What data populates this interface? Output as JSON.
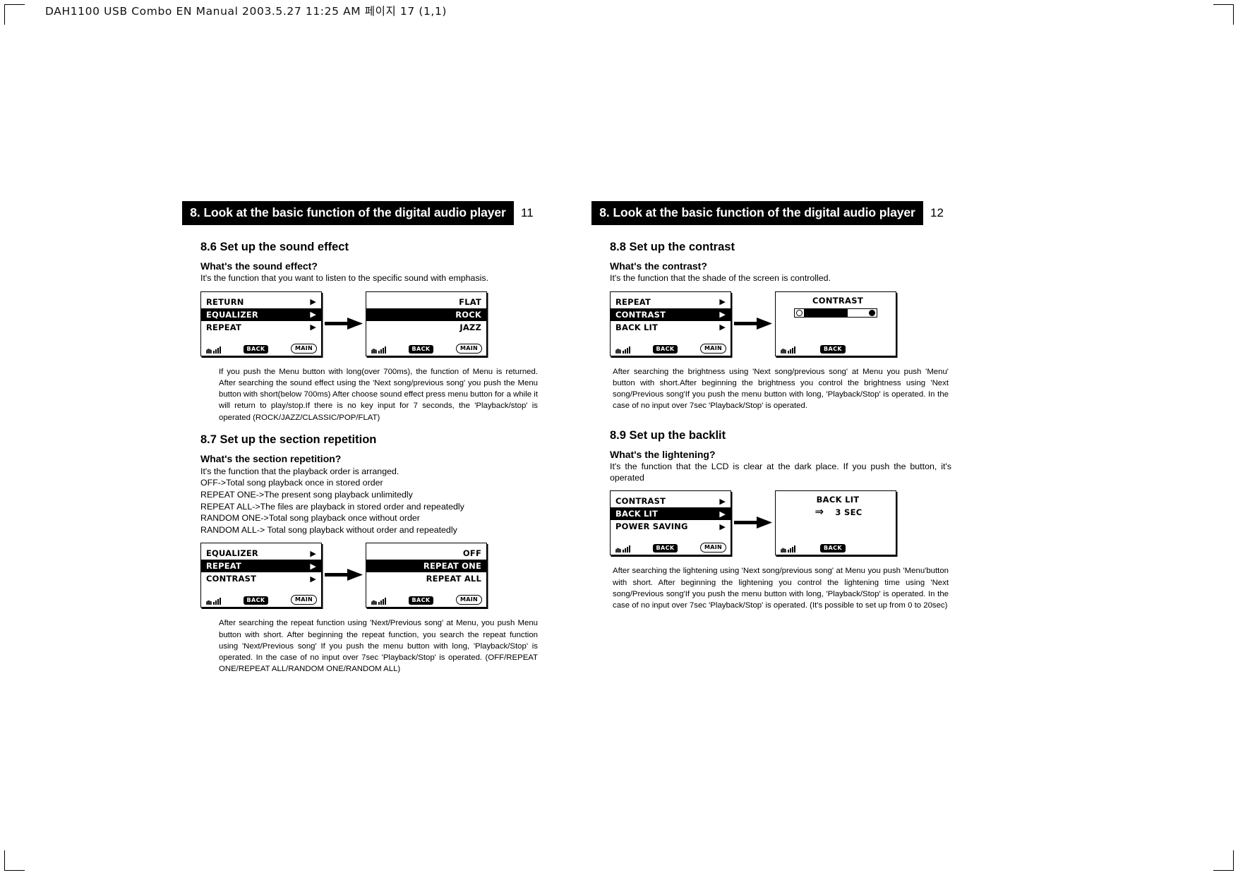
{
  "print_header": "DAH1100 USB Combo EN Manual  2003.5.27 11:25 AM  페이지 17 (1,1)",
  "left_page": {
    "banner": "8. Look at the basic function of the digital audio player",
    "page_number": "11",
    "section_86": {
      "title": "8.6 Set up the sound effect",
      "question": "What's the sound effect?",
      "answer": "It's the function that you want to listen to the specific sound with emphasis.",
      "figure": {
        "screen_a": {
          "rows": [
            {
              "label": "RETURN",
              "selected": false,
              "arrow": "▶"
            },
            {
              "label": "EQUALIZER",
              "selected": true,
              "arrow": "▶"
            },
            {
              "label": "REPEAT",
              "selected": false,
              "arrow": "▶"
            }
          ],
          "status": {
            "signal": "signal-icon",
            "back": "BACK",
            "main": "MAIN"
          }
        },
        "arrow": "→",
        "screen_b": {
          "rows": [
            {
              "label": "FLAT",
              "selected": false
            },
            {
              "label": "ROCK",
              "selected": true
            },
            {
              "label": "JAZZ",
              "selected": false
            }
          ],
          "status": {
            "signal": "signal-icon",
            "back": "BACK",
            "main": "MAIN"
          }
        }
      },
      "note": "If you push the Menu button with long(over 700ms), the function of Menu is returned. After searching the sound effect using the 'Next song/previous song' you push the Menu button with short(below 700ms) After choose sound effect press menu button for a while it will return to play/stop.If there is no key input for 7 seconds, the 'Playback/stop' is operated (ROCK/JAZZ/CLASSIC/POP/FLAT)"
    },
    "section_87": {
      "title": "8.7 Set up the section repetition",
      "question": "What's the section repetition?",
      "lines": [
        "It's the function that the playback order is arranged.",
        "OFF->Total song playback once in stored order",
        "REPEAT ONE->The present song playback unlimitedly",
        "REPEAT ALL->The files are playback in stored order and repeatedly",
        "RANDOM ONE->Total song playback once without order",
        "RANDOM ALL-> Total song playback without order and repeatedly"
      ],
      "figure": {
        "screen_a": {
          "rows": [
            {
              "label": "EQUALIZER",
              "selected": false,
              "arrow": "▶"
            },
            {
              "label": "REPEAT",
              "selected": true,
              "arrow": "▶"
            },
            {
              "label": "CONTRAST",
              "selected": false,
              "arrow": "▶"
            }
          ],
          "status": {
            "signal": "signal-icon",
            "back": "BACK",
            "main": "MAIN"
          }
        },
        "arrow": "→",
        "screen_b": {
          "rows": [
            {
              "label": "OFF",
              "selected": false
            },
            {
              "label": "REPEAT ONE",
              "selected": true
            },
            {
              "label": "REPEAT ALL",
              "selected": false
            }
          ],
          "status": {
            "signal": "signal-icon",
            "back": "BACK",
            "main": "MAIN"
          }
        }
      },
      "note": "After searching the repeat function using 'Next/Previous song' at Menu, you push Menu button with short. After beginning the repeat function, you search the repeat function using 'Next/Previous song' If you push the menu button with long, 'Playback/Stop' is operated. In the case of no input over 7sec 'Playback/Stop' is operated. (OFF/REPEAT ONE/REPEAT ALL/RANDOM ONE/RANDOM ALL)"
    }
  },
  "right_page": {
    "banner": "8. Look at the basic function of the digital audio player",
    "page_number": "12",
    "section_88": {
      "title": "8.8 Set up the contrast",
      "question": "What's the contrast?",
      "answer": "It's the function that the shade of the screen is controlled.",
      "figure": {
        "screen_a": {
          "rows": [
            {
              "label": "REPEAT",
              "selected": false,
              "arrow": "▶"
            },
            {
              "label": "CONTRAST",
              "selected": true,
              "arrow": "▶"
            },
            {
              "label": "BACK LIT",
              "selected": false,
              "arrow": "▶"
            }
          ],
          "status": {
            "signal": "signal-icon",
            "back": "BACK",
            "main": "MAIN"
          }
        },
        "arrow": "→",
        "screen_b": {
          "title": "CONTRAST",
          "slider": {
            "icon": "brightness-icon",
            "fill_percent": 62
          },
          "status": {
            "signal": "signal-icon",
            "back": "BACK"
          }
        }
      },
      "note": "After searching the brightness using 'Next song/previous song' at Menu you push 'Menu' button with short.After beginning the brightness you control the brightness using 'Next song/Previous song'If you push the menu button with long, 'Playback/Stop' is operated. In the case of no input over 7sec 'Playback/Stop' is operated."
    },
    "section_89": {
      "title": "8.9 Set up the backlit",
      "question": "What's the lightening?",
      "answer": "It's the function that the LCD is clear at the dark place. If you push the button, it's operated",
      "figure": {
        "screen_a": {
          "rows": [
            {
              "label": "CONTRAST",
              "selected": false,
              "arrow": "▶"
            },
            {
              "label": "BACK LIT",
              "selected": true,
              "arrow": "▶"
            },
            {
              "label": "POWER SAVING",
              "selected": false,
              "arrow": "▶"
            }
          ],
          "status": {
            "signal": "signal-icon",
            "back": "BACK",
            "main": "MAIN"
          }
        },
        "arrow": "→",
        "screen_b": {
          "title": "BACK LIT",
          "value": "3 SEC",
          "value_arrow": "⇒",
          "status": {
            "signal": "signal-icon",
            "back": "BACK"
          }
        }
      },
      "note": "After searching the lightening using 'Next song/previous song' at Menu you push 'Menu'button with short. After beginning the lightening you control the lightening time using 'Next song/Previous song'If you push the menu button with long, 'Playback/Stop' is operated. In the case of no input over 7sec 'Playback/Stop' is operated. (It's possible to set up from 0 to 20sec)"
    }
  }
}
